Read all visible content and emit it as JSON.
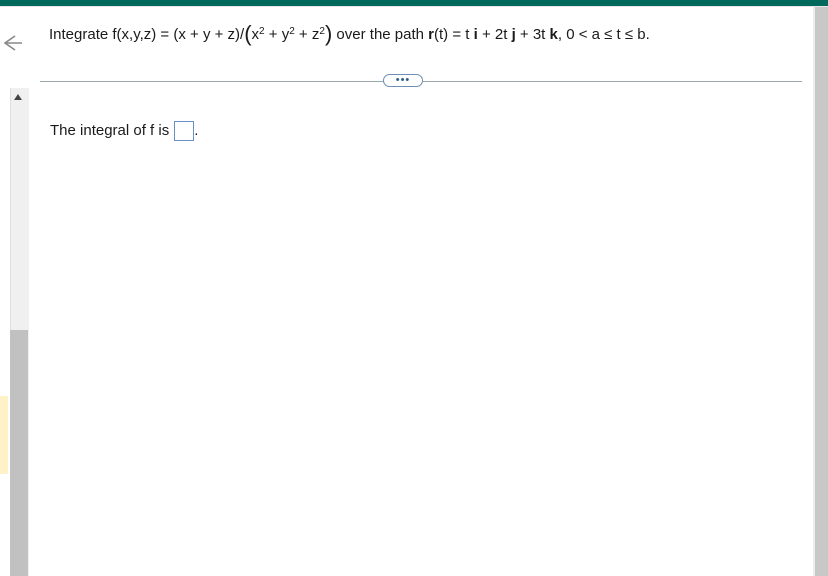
{
  "question": {
    "prefix": "Integrate f(x,y,z) = (x + y + z)/",
    "open_paren": "(",
    "x_term": "x",
    "plus1": " + ",
    "y_term": "y",
    "plus2": " + ",
    "z_term": "z",
    "exponent": "2",
    "close_paren": ")",
    "mid": " over the path ",
    "r_bold": "r",
    "r_rest": "(t) = t ",
    "i_bold": "i",
    "i_rest": " + 2t ",
    "j_bold": "j",
    "j_rest": " + 3t ",
    "k_bold": "k",
    "tail": ", 0 < a ≤ t ≤ b."
  },
  "more_button": {
    "label": "•••"
  },
  "answer": {
    "label": "The integral of f is",
    "value": "",
    "period": "."
  },
  "colors": {
    "topbar": "#00695c",
    "answer_border": "#6a8fc7",
    "pill_border": "#6c8fb5"
  },
  "icons": {
    "back": "back-arrow-icon",
    "scroll_up": "scroll-up-arrow-icon"
  }
}
